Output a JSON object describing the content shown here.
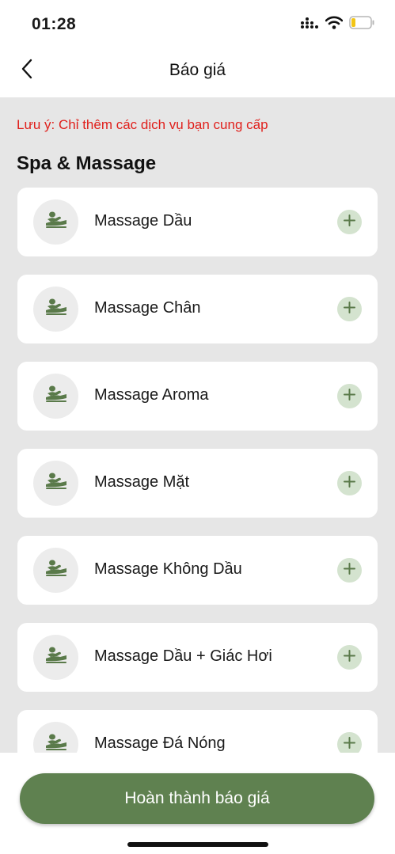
{
  "status_bar": {
    "time": "01:28"
  },
  "nav": {
    "title": "Báo giá"
  },
  "note": "Lưu ý: Chỉ thêm các dịch vụ bạn cung cấp",
  "section": {
    "title": "Spa & Massage",
    "items": [
      {
        "label": "Massage Dầu",
        "icon": "massage-icon"
      },
      {
        "label": "Massage Chân",
        "icon": "massage-icon"
      },
      {
        "label": "Massage Aroma",
        "icon": "massage-icon"
      },
      {
        "label": "Massage Mặt",
        "icon": "massage-icon"
      },
      {
        "label": "Massage Không Dầu",
        "icon": "massage-icon"
      },
      {
        "label": "Massage Dầu + Giác Hơi",
        "icon": "massage-icon"
      },
      {
        "label": "Massage Đá Nóng",
        "icon": "massage-icon"
      }
    ]
  },
  "actions": {
    "complete_label": "Hoàn thành báo giá"
  },
  "colors": {
    "accent": "#5f8150",
    "warning": "#e0201c",
    "icon_green": "#5a7a4a",
    "add_bg": "#d4e3cf"
  }
}
